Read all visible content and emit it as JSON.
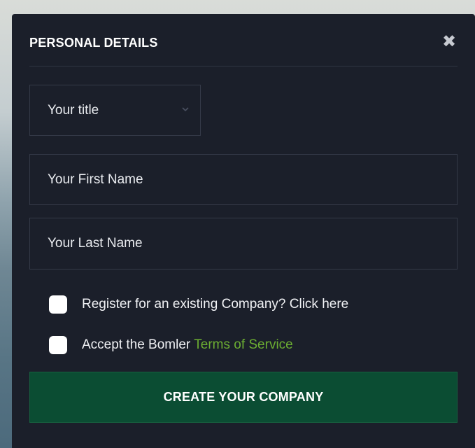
{
  "modal": {
    "title": "PERSONAL DETAILS",
    "close_symbol": "✖"
  },
  "form": {
    "title_select": {
      "value": "Your title",
      "icon": "chevron-down-icon"
    },
    "first_name_placeholder": "Your First Name",
    "last_name_placeholder": "Your Last Name",
    "existing_company": {
      "label": "Register for an existing Company? Click here",
      "checked": false
    },
    "terms": {
      "label": "Accept the Bomler",
      "link_text": "Terms of Service",
      "checked": false
    },
    "submit_label": "CREATE YOUR COMPANY"
  },
  "colors": {
    "modal_bg": "#1b1f2a",
    "field_border": "#353a48",
    "link": "#6cae32",
    "button_bg": "#0b4d33"
  }
}
